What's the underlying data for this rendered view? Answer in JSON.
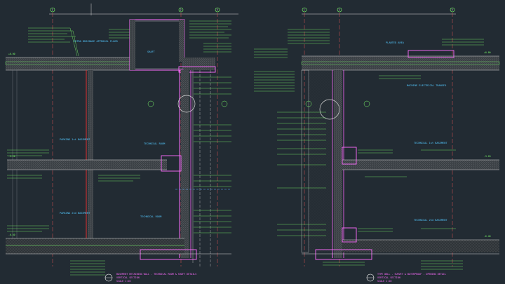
{
  "drawing": {
    "left_title": {
      "line1": "BASEMENT RETAINING WALL - TECHNICAL ROOM & SHAFT DETAILS",
      "line2": "VERTICAL SECTION",
      "line3": "SCALE 1:20"
    },
    "right_title": {
      "line1": "TYPE WALL - SURVEY & WATERPROOF - OPENING DETAIL",
      "line2": "VERTICAL SECTION",
      "line3": "SCALE 1:20"
    },
    "left_room_labels": [
      "EXTRA DRAINAGE APPROVAL FLOOR",
      "SHAFT",
      "PARKING 1st BASEMENT",
      "TECHNICAL ROOM",
      "PARKING 2nd BASEMENT",
      "TECHNICAL ROOM"
    ],
    "right_room_labels": [
      "PLANTED AREA",
      "TECHNICAL 1st BASEMENT",
      "TECHNICAL 2nd BASEMENT",
      "MACHINE ELECTRICAL TRANSFO"
    ],
    "grid_markers": [
      "1",
      "2",
      "3",
      "1",
      "2",
      "3"
    ],
    "level_markers": [
      "+0.00",
      "-3.20",
      "-6.40",
      "+0.00",
      "-3.20",
      "-6.40"
    ]
  }
}
